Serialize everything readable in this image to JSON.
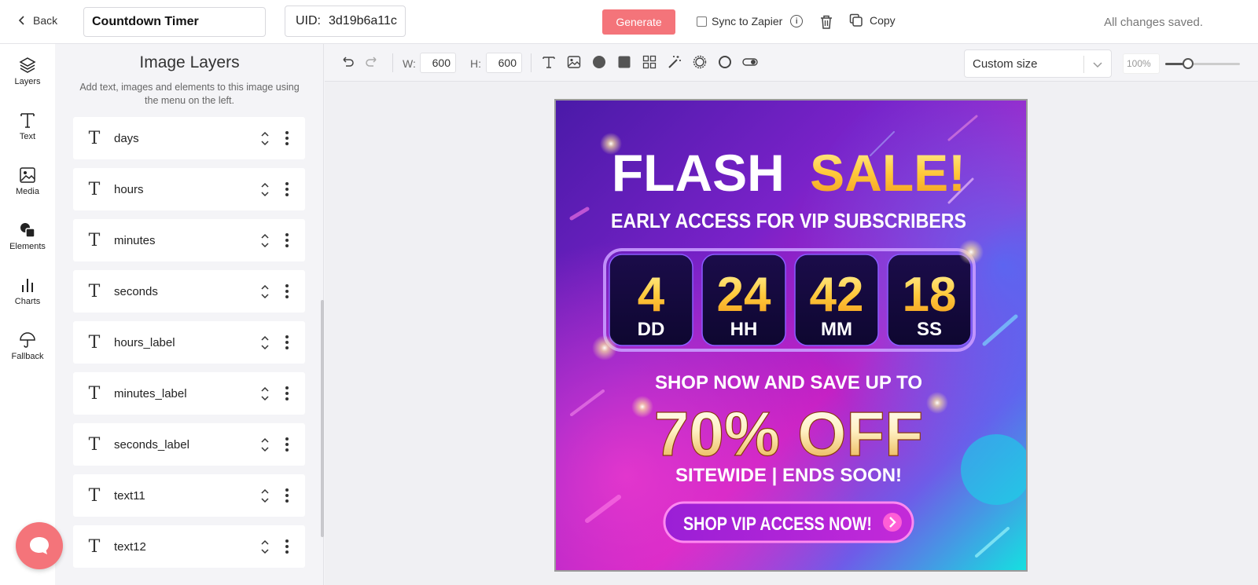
{
  "header": {
    "back_label": "Back",
    "template_name": "Countdown Timer",
    "uid_label": "UID:",
    "uid_value": "3d19b6a11c",
    "generate_label": "Generate",
    "sync_label": "Sync to Zapier",
    "copy_label": "Copy",
    "status": "All changes saved."
  },
  "rail": [
    {
      "label": "Layers",
      "icon": "layers-icon"
    },
    {
      "label": "Text",
      "icon": "text-icon"
    },
    {
      "label": "Media",
      "icon": "image-icon"
    },
    {
      "label": "Elements",
      "icon": "shapes-icon"
    },
    {
      "label": "Charts",
      "icon": "bar-chart-icon"
    },
    {
      "label": "Fallback",
      "icon": "umbrella-icon"
    }
  ],
  "panel": {
    "title": "Image Layers",
    "subtitle": "Add text, images and elements to this image using the menu on the left.",
    "layers": [
      "days",
      "hours",
      "minutes",
      "seconds",
      "hours_label",
      "minutes_label",
      "seconds_label",
      "text11",
      "text12"
    ]
  },
  "toolbar": {
    "w_label": "W:",
    "w_value": "600",
    "h_label": "H:",
    "h_value": "600",
    "size_preset": "Custom size",
    "zoom": "100%",
    "zoom_level": 0.3
  },
  "artwork": {
    "headline_white": "FLASH",
    "headline_gold": "SALE!",
    "subhead": "EARLY ACCESS FOR VIP SUBSCRIBERS",
    "countdown": [
      {
        "value": "4",
        "label": "DD"
      },
      {
        "value": "24",
        "label": "HH"
      },
      {
        "value": "42",
        "label": "MM"
      },
      {
        "value": "18",
        "label": "SS"
      }
    ],
    "promo_line": "SHOP NOW AND SAVE UP TO",
    "discount": "70% OFF",
    "tagline": "SITEWIDE | ENDS SOON!",
    "cta": "SHOP VIP ACCESS NOW!"
  },
  "colors": {
    "accent": "#f4747a",
    "gold": "#ffc93c",
    "bg_purple": "#5a1fb8",
    "bg_magenta": "#d61fc2",
    "bg_cyan": "#19d3e8"
  }
}
